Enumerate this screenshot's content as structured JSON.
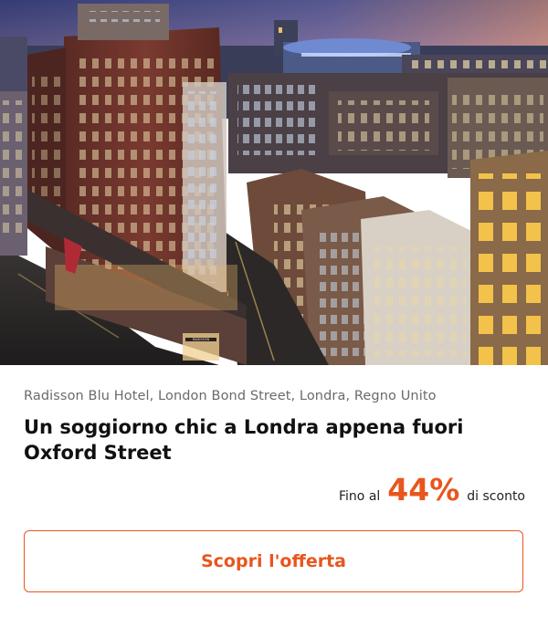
{
  "offer": {
    "location": "Radisson Blu Hotel, London Bond Street, Londra, Regno Unito",
    "title": "Un soggiorno chic a Londra appena fuori Oxford Street",
    "discount": {
      "prefix": "Fino al",
      "value": "44%",
      "suffix": "di sconto"
    },
    "cta_label": "Scopri l'offerta",
    "image_sign_text": "RADISSON"
  },
  "colors": {
    "accent": "#e8561e",
    "location_text": "#6a6a6a",
    "title_text": "#111111"
  }
}
